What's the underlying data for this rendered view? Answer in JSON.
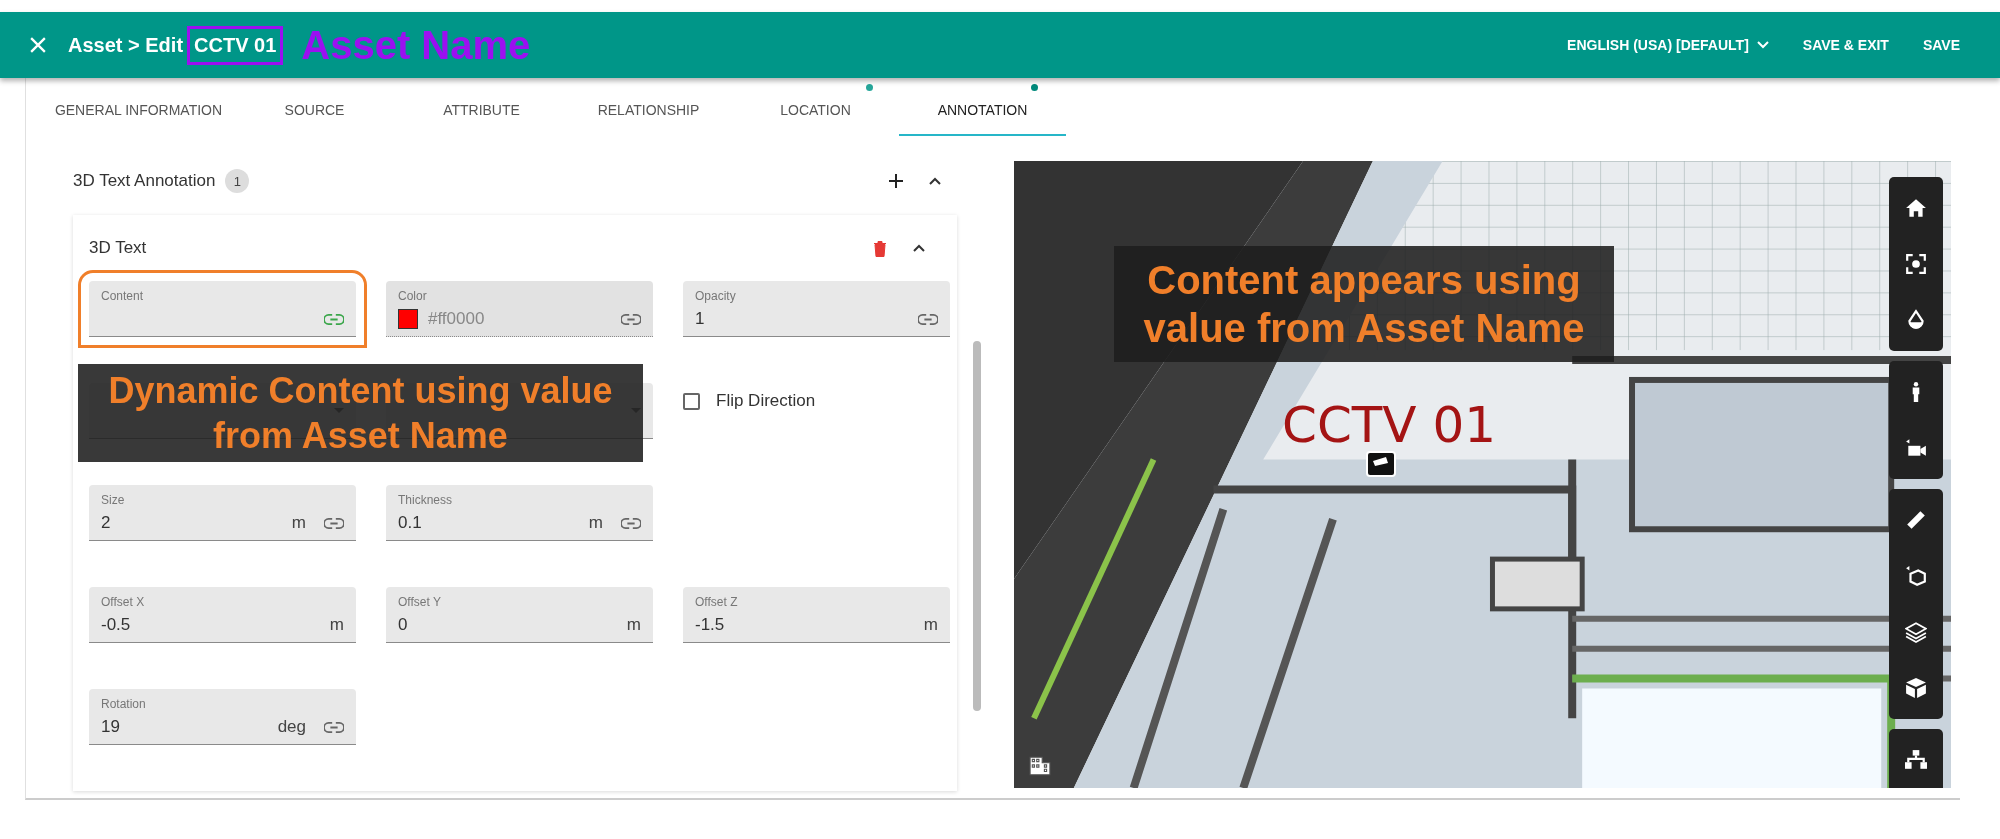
{
  "header": {
    "title": "Asset > Edit",
    "asset_name": "CCTV 01",
    "callout": "Asset Name",
    "language": "ENGLISH (USA) [DEFAULT]",
    "actions": [
      "SAVE & EXIT",
      "SAVE"
    ]
  },
  "tabs": [
    {
      "label": "GENERAL INFORMATION",
      "selected": false,
      "dot": false
    },
    {
      "label": "SOURCE",
      "selected": false,
      "dot": false
    },
    {
      "label": "ATTRIBUTE",
      "selected": false,
      "dot": false
    },
    {
      "label": "RELATIONSHIP",
      "selected": false,
      "dot": false
    },
    {
      "label": "LOCATION",
      "selected": false,
      "dot": true
    },
    {
      "label": "ANNOTATION",
      "selected": true,
      "dot": true
    }
  ],
  "section": {
    "title": "3D Text Annotation",
    "count": "1",
    "expanded": true,
    "item": {
      "title": "3D Text",
      "expanded": true,
      "rows": [
        [
          {
            "kind": "text",
            "label": "Content",
            "link_active": true,
            "highlighted": true
          },
          {
            "kind": "color",
            "label": "Color",
            "value": "#ff0000",
            "color": "#ff0000",
            "disabled": true,
            "link_active": false
          },
          {
            "kind": "text",
            "label": "Opacity",
            "value": "1",
            "link_active": false
          }
        ],
        [
          {
            "kind": "select"
          },
          {
            "kind": "select"
          },
          {
            "kind": "checkbox",
            "label": "Flip Direction",
            "checked": false
          }
        ],
        [
          {
            "kind": "text",
            "label": "Size",
            "value": "2",
            "unit": "m",
            "link_active": false
          },
          {
            "kind": "text",
            "label": "Thickness",
            "value": "0.1",
            "unit": "m",
            "link_active": false
          }
        ],
        [
          {
            "kind": "text",
            "label": "Offset X",
            "value": "-0.5",
            "unit": "m"
          },
          {
            "kind": "text",
            "label": "Offset Y",
            "value": "0",
            "unit": "m"
          },
          {
            "kind": "text",
            "label": "Offset Z",
            "value": "-1.5",
            "unit": "m"
          }
        ],
        [
          {
            "kind": "text",
            "label": "Rotation",
            "value": "19",
            "unit": "deg",
            "link_active": false
          }
        ]
      ]
    }
  },
  "form_callout": "Dynamic Content using value from Asset Name",
  "viewer": {
    "label_3d": "CCTV 01",
    "callout": "Content appears using value from Asset Name"
  }
}
